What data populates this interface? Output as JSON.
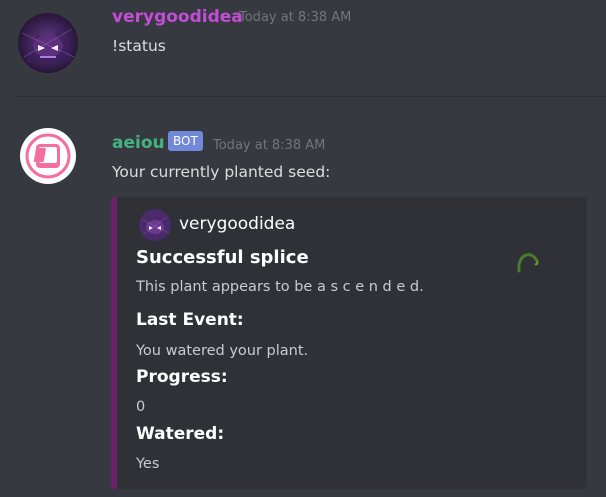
{
  "colors": {
    "background": "#36393f",
    "embed_background": "#2f3136",
    "embed_accent": "#6d1f6a",
    "user_name_color": "#c34dd6",
    "bot_name_color": "#43b581",
    "bot_tag_color": "#7289da"
  },
  "messages": [
    {
      "username": "verygoodidea",
      "timestamp": "Today at 8:38 AM",
      "content": "!status",
      "avatar_icon": "purple-ghost-avatar"
    },
    {
      "username": "aeiou",
      "badge": "BOT",
      "timestamp": "Today at 8:38 AM",
      "content": "Your currently planted seed:",
      "avatar_icon": "pink-tablet-avatar",
      "embed": {
        "author": "verygoodidea",
        "title": "Successful splice",
        "description": "This plant appears to be  a s c e n d e d.",
        "thumbnail_icon": "green-sprout-icon",
        "fields": [
          {
            "name": "Last Event:",
            "value": "You watered your plant."
          },
          {
            "name": "Progress:",
            "value": "0"
          },
          {
            "name": "Watered:",
            "value": "Yes"
          }
        ]
      }
    }
  ]
}
